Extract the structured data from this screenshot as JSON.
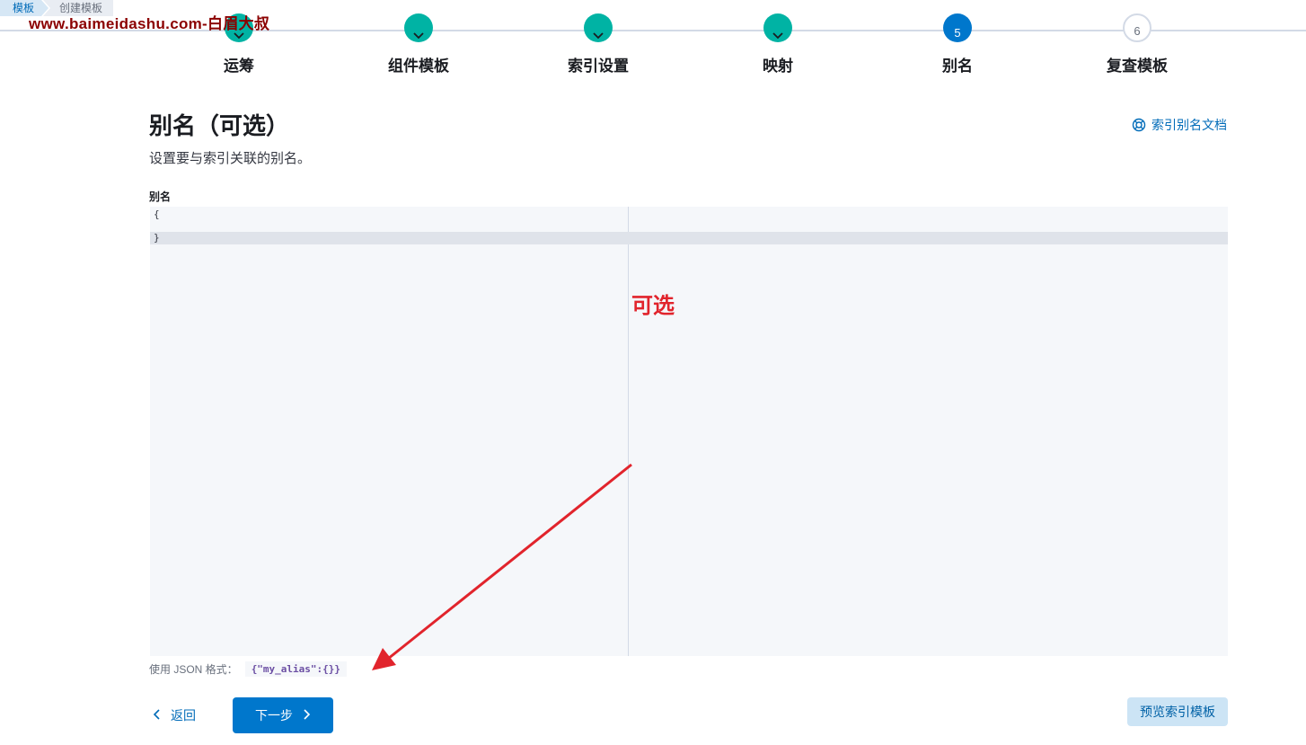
{
  "breadcrumbs": [
    "模板",
    "创建模板"
  ],
  "watermark": "www.baimeidashu.com-白眉大叔",
  "steps": [
    {
      "label": "运筹",
      "status": "done",
      "number": ""
    },
    {
      "label": "组件模板",
      "status": "done",
      "number": ""
    },
    {
      "label": "索引设置",
      "status": "done",
      "number": ""
    },
    {
      "label": "映射",
      "status": "done",
      "number": ""
    },
    {
      "label": "别名",
      "status": "current",
      "number": "5"
    },
    {
      "label": "复查模板",
      "status": "todo",
      "number": "6"
    }
  ],
  "page": {
    "title": "别名（可选）",
    "subtitle": "设置要与索引关联的别名。",
    "docs_link": "索引别名文档"
  },
  "editor": {
    "label": "别名",
    "lines": [
      "{",
      "",
      "}"
    ],
    "annotation": "可选"
  },
  "help": {
    "text": "使用 JSON 格式：",
    "example": "{\"my_alias\":{}}"
  },
  "buttons": {
    "back": "返回",
    "next": "下一步",
    "preview": "预览索引模板"
  },
  "colors": {
    "accent": "#0077cc",
    "done_step": "#00b3a4",
    "annotation": "#e1242c"
  }
}
